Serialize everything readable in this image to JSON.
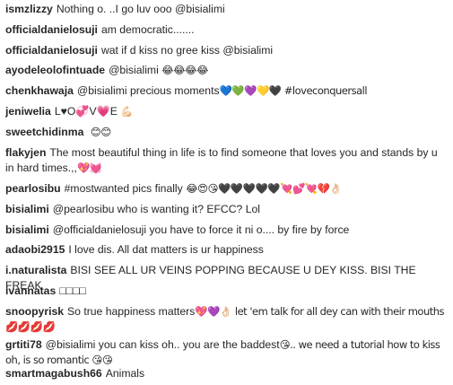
{
  "comments": [
    {
      "username": "ismzlizzy",
      "text": "Nothing o. ..I go luv ooo @bisialimi",
      "emoji": ""
    },
    {
      "username": "officialdanielosuji",
      "text": "am democratic.......",
      "emoji": ""
    },
    {
      "username": "officialdanielosuji",
      "text": "wat if d kiss no gree kiss @bisialimi",
      "emoji": ""
    },
    {
      "username": "ayodeleolofintuade",
      "text": "@bisialimi",
      "emoji": "😂😂😂😂"
    },
    {
      "username": "chenkhawaja",
      "text": "@bisialimi precious moments",
      "emoji": "💙💚💜💛🖤 #loveconquersall"
    },
    {
      "username": "jeniwelia",
      "text": "L♥O💞V💗E",
      "emoji": "💪🏻"
    },
    {
      "username": "sweetchidinma",
      "text": "",
      "emoji": "😊😊"
    },
    {
      "username": "flakyjen",
      "text": "The most beautiful thing in life is to find someone that loves you and stands by u in hard times.,,",
      "emoji": "💖💓"
    },
    {
      "username": "pearlosibu",
      "text": "#mostwanted pics finally",
      "emoji": "😂😍😘🖤🖤🖤🖤🖤💘💕💘💔👌🏻"
    },
    {
      "username": "bisialimi",
      "text": "@pearlosibu who is wanting it? EFCC? Lol",
      "emoji": ""
    },
    {
      "username": "bisialimi",
      "text": "@officialdanielosuji you have to force it ni o.... by fire by force",
      "emoji": ""
    },
    {
      "username": "adaobi2915",
      "text": "I love dis. All dat matters is ur happiness",
      "emoji": ""
    },
    {
      "username": "i.naturalista",
      "text": "BISI SEE ALL UR VEINS POPPING BECAUSE U DEY KISS. BISI THE FREAK",
      "emoji": ""
    },
    {
      "username": "ivannatas",
      "text": "□□□□",
      "emoji": ""
    },
    {
      "username": "snoopyrisk",
      "text": "So true happiness matters",
      "emoji": "💖💜👌🏻 let 'em talk for all dey can with their mouths💋💋💋💋"
    },
    {
      "username": "grtiti78",
      "text": "@bisialimi you can kiss oh.. you are the baddest",
      "emoji": "😘.. we need a tutorial how to kiss oh, is so romantic 😘😘"
    },
    {
      "username": "smartmagabush66",
      "text": "Animals",
      "emoji": ""
    }
  ]
}
